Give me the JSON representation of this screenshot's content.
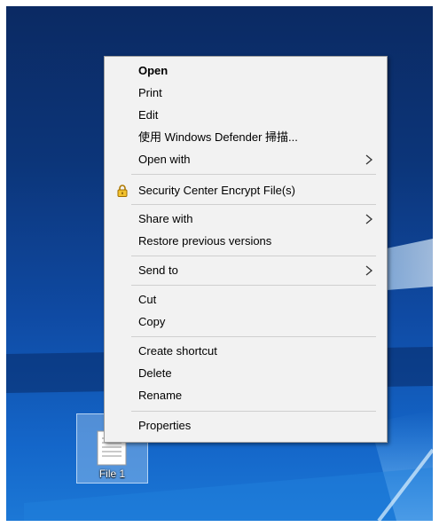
{
  "desktop": {
    "icon": {
      "name": "File 1",
      "icon_name": "document-icon"
    }
  },
  "context_menu": {
    "items": [
      {
        "label": "Open"
      },
      {
        "label": "Print"
      },
      {
        "label": "Edit"
      },
      {
        "label": "使用 Windows Defender 掃描..."
      },
      {
        "label": "Open with",
        "submenu": true
      },
      {
        "label": "Security Center Encrypt File(s)",
        "icon_name": "lock-icon"
      },
      {
        "label": "Share with",
        "submenu": true
      },
      {
        "label": "Restore previous versions"
      },
      {
        "label": "Send to",
        "submenu": true
      },
      {
        "label": "Cut"
      },
      {
        "label": "Copy"
      },
      {
        "label": "Create shortcut"
      },
      {
        "label": "Delete"
      },
      {
        "label": "Rename"
      },
      {
        "label": "Properties"
      }
    ]
  },
  "colors": {
    "menu_background": "#f2f2f2",
    "separator": "#cfcfcf",
    "wallpaper_accent": "#1c78d6"
  }
}
